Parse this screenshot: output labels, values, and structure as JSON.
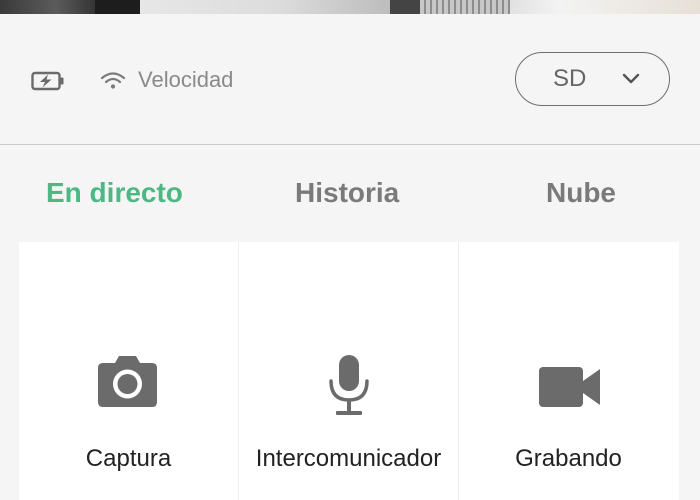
{
  "toolbar": {
    "battery_icon": "battery-charging-icon",
    "wifi_icon": "wifi-icon",
    "speed_label": "Velocidad",
    "quality": {
      "value": "SD",
      "icon": "chevron-down-icon"
    }
  },
  "tabs": [
    {
      "label": "En directo",
      "active": true
    },
    {
      "label": "Historia",
      "active": false
    },
    {
      "label": "Nube",
      "active": false
    }
  ],
  "actions": [
    {
      "label": "Captura",
      "icon": "camera-icon"
    },
    {
      "label": "Intercomunicador",
      "icon": "microphone-icon"
    },
    {
      "label": "Grabando",
      "icon": "video-camera-icon"
    }
  ],
  "colors": {
    "accent": "#4eb884",
    "tab_inactive": "#7a7a7a",
    "icon": "#6b6b6b",
    "background": "#f5f5f5",
    "panel": "#ffffff"
  }
}
